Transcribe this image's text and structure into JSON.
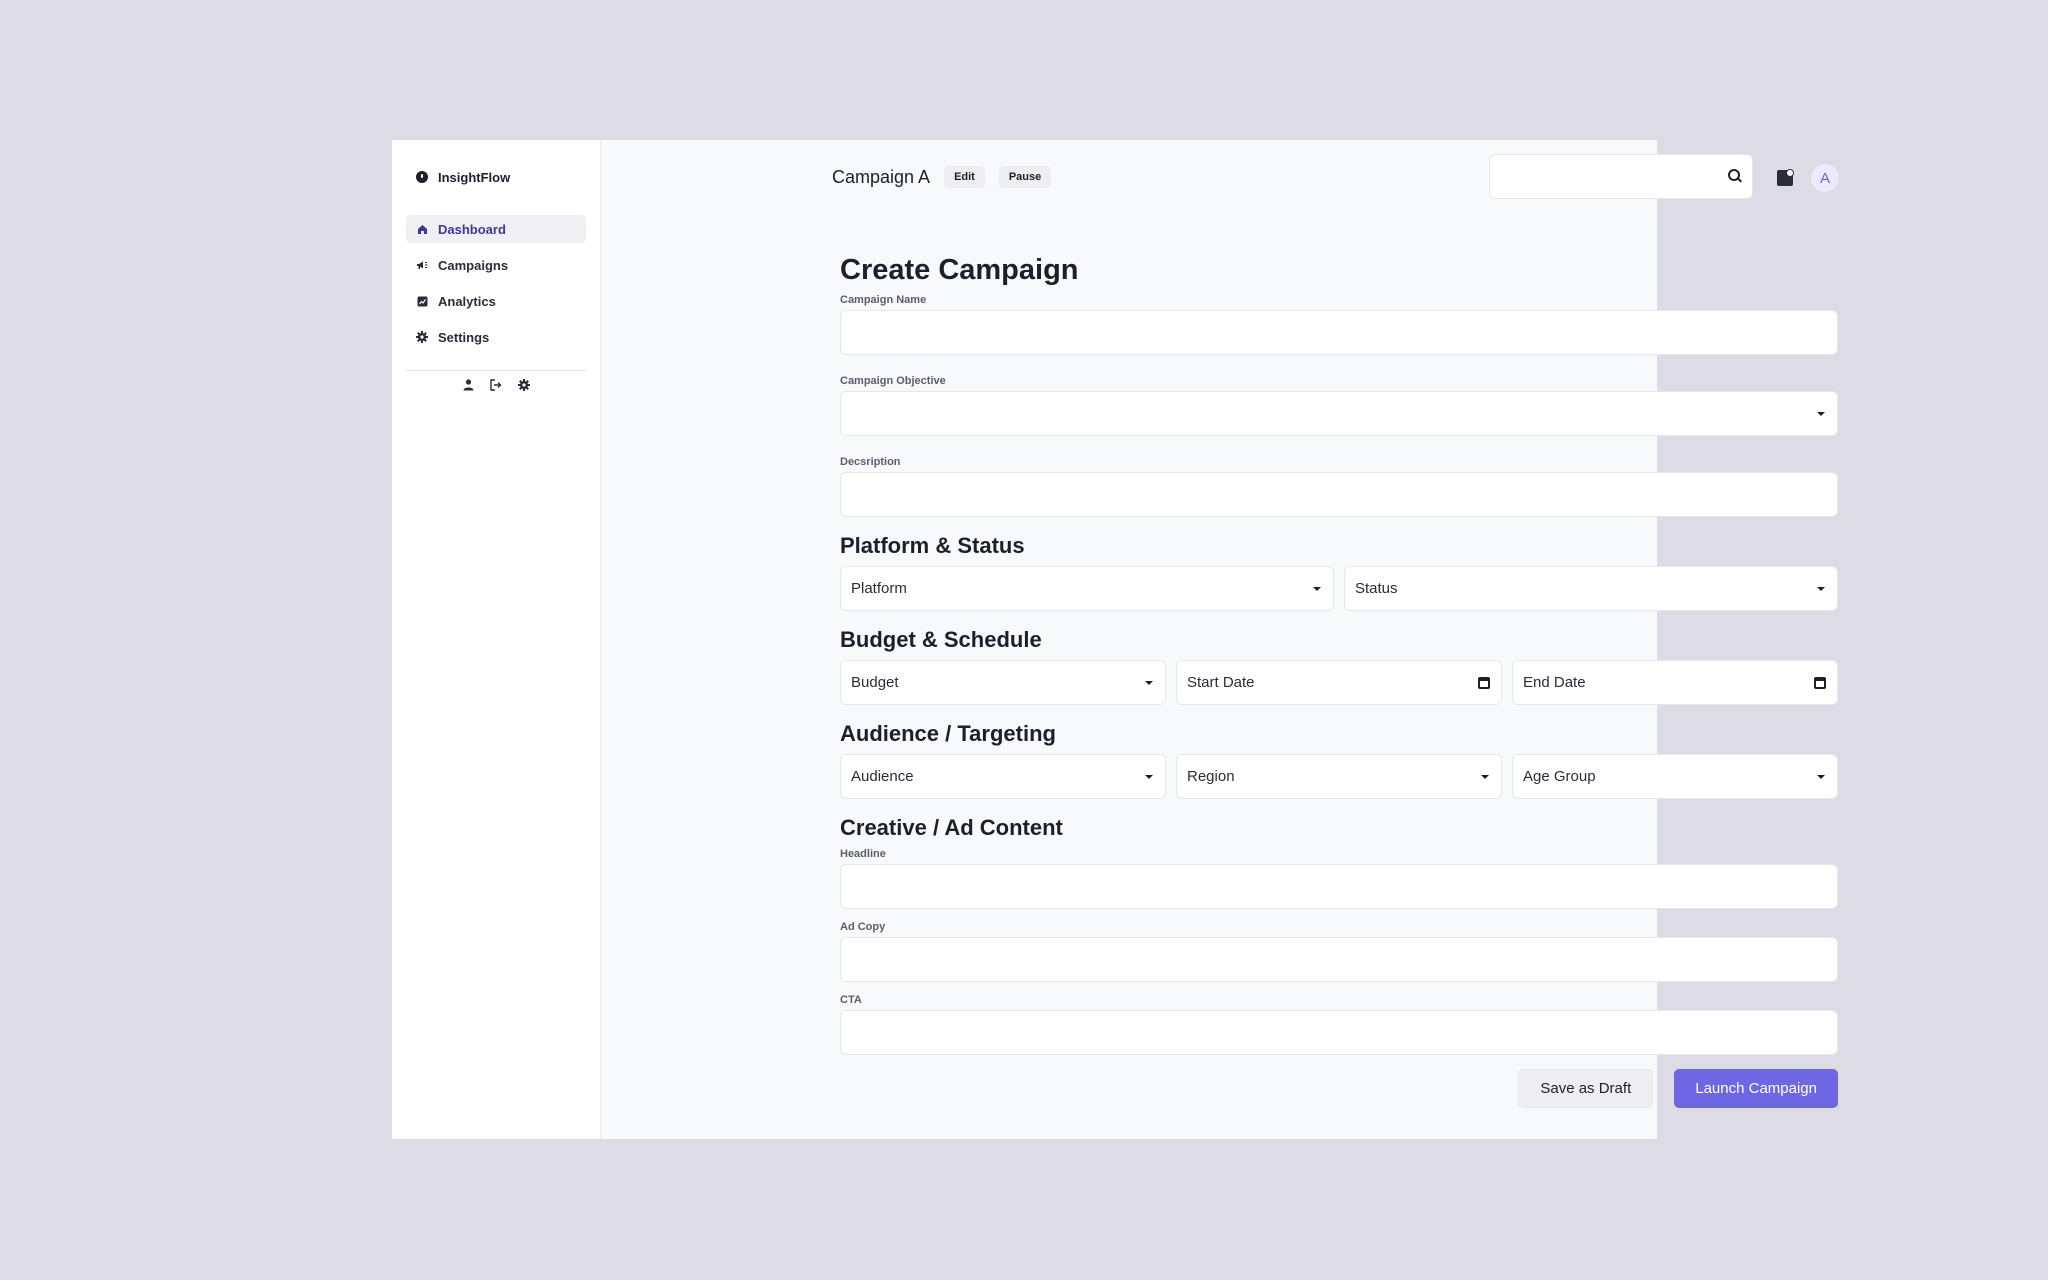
{
  "brand": {
    "name": "InsightFlow"
  },
  "sidebar": {
    "items": [
      {
        "label": "Dashboard",
        "icon": "home-icon",
        "active": true
      },
      {
        "label": "Campaigns",
        "icon": "megaphone-icon",
        "active": false
      },
      {
        "label": "Analytics",
        "icon": "chart-icon",
        "active": false
      },
      {
        "label": "Settings",
        "icon": "gear-icon",
        "active": false
      }
    ],
    "footer_icons": [
      "user-icon",
      "logout-icon",
      "gear-icon"
    ]
  },
  "header": {
    "title": "Campaign A",
    "edit_label": "Edit",
    "pause_label": "Pause",
    "search": {
      "value": "",
      "placeholder": ""
    },
    "avatar_initial": "A"
  },
  "form": {
    "title": "Create Campaign",
    "campaign_name": {
      "label": "Campaign Name",
      "value": ""
    },
    "campaign_objective": {
      "label": "Campaign Objective",
      "value": ""
    },
    "description": {
      "label": "Decsription",
      "value": ""
    },
    "platform_section": "Platform & Status",
    "platform": "Platform",
    "status": "Status",
    "budget_section": "Budget & Schedule",
    "budget": "Budget",
    "start_date": "Start Date",
    "end_date": "End Date",
    "audience_section": "Audience / Targeting",
    "audience": "Audience",
    "region": "Region",
    "age_group": "Age Group",
    "creative_section": "Creative / Ad Content",
    "headline": {
      "label": "Headline",
      "value": ""
    },
    "ad_copy": {
      "label": "Ad Copy",
      "value": ""
    },
    "cta": {
      "label": "CTA",
      "value": ""
    },
    "save_draft_label": "Save as Draft",
    "launch_label": "Launch Campaign"
  },
  "colors": {
    "accent": "#6f66e4",
    "active_nav_text": "#3d3a8f",
    "background": "#dddbe6"
  }
}
